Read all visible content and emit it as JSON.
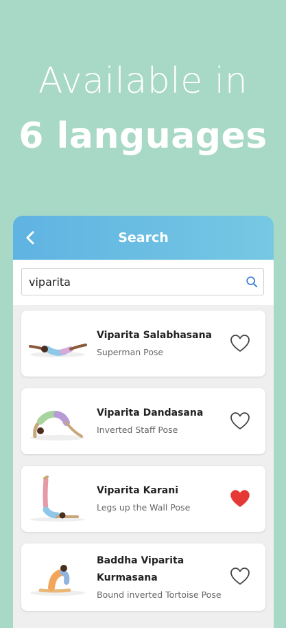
{
  "headline": {
    "line1": "Available in",
    "line2": "6 languages"
  },
  "appbar": {
    "title": "Search",
    "back_icon": "chevron-left-icon"
  },
  "search": {
    "value": "viparita",
    "placeholder": "Search",
    "icon": "search-icon"
  },
  "colors": {
    "background": "#a8d8c6",
    "appbar_start": "#5fb3e2",
    "appbar_end": "#76c8e3",
    "favorite_active": "#e53935"
  },
  "results": [
    {
      "title": "Viparita Salabhasana",
      "subtitle": "Superman Pose",
      "favorited": false
    },
    {
      "title": "Viparita Dandasana",
      "subtitle": "Inverted Staff Pose",
      "favorited": false
    },
    {
      "title": "Viparita Karani",
      "subtitle": "Legs up the Wall Pose",
      "favorited": true
    },
    {
      "title": "Baddha Viparita Kurmasana",
      "subtitle": "Bound inverted Tortoise Pose",
      "favorited": false
    }
  ]
}
